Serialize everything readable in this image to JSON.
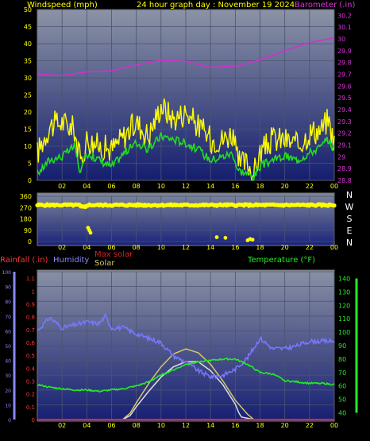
{
  "chart_data": [
    {
      "type": "line",
      "title": "24 hour graph day : November 19 2024",
      "ylabel": "Windspeed (mph)",
      "y2label": "Barometer (.in)",
      "x_ticks": [
        "02",
        "04",
        "06",
        "08",
        "10",
        "12",
        "14",
        "16",
        "18",
        "20",
        "22",
        "00"
      ],
      "ylim": [
        0,
        50
      ],
      "y_ticks": [
        0,
        5,
        10,
        15,
        20,
        25,
        30,
        35,
        40,
        45,
        50
      ],
      "y2lim": [
        28.8,
        30.25
      ],
      "y2_ticks": [
        "28.8",
        "28.9",
        "29",
        "29.1",
        "29.2",
        "29.3",
        "29.4",
        "29.5",
        "29.6",
        "29.7",
        "29.8",
        "29.9",
        "30",
        "30.1",
        "30.2"
      ],
      "colors": {
        "gust": "#ffff00",
        "average": "#22dd22",
        "barometer": "#cc33cc"
      },
      "series": [
        {
          "key": "gust",
          "x": [
            0,
            1,
            2,
            3,
            3.5,
            4,
            5,
            6,
            7,
            8,
            9,
            10,
            11,
            12,
            13,
            14,
            15,
            15.8,
            16.2,
            17,
            17.5,
            18,
            19,
            20,
            21,
            22,
            23,
            23.5,
            24
          ],
          "values": [
            8,
            16,
            17,
            15,
            5,
            12,
            10,
            9,
            13,
            17,
            13,
            22,
            18,
            20,
            16,
            12,
            12,
            14,
            5,
            5,
            2,
            8,
            12,
            12,
            10,
            14,
            15,
            18,
            11
          ]
        },
        {
          "key": "average",
          "x": [
            0,
            1,
            2,
            3,
            3.5,
            4,
            5,
            6,
            7,
            8,
            9,
            10,
            11,
            12,
            13,
            14,
            15,
            15.8,
            16.2,
            17,
            17.5,
            18,
            19,
            20,
            21,
            22,
            23,
            23.5,
            24
          ],
          "values": [
            2,
            6,
            7,
            10,
            2,
            8,
            6,
            4,
            8,
            11,
            9,
            13,
            12,
            11,
            9,
            6,
            7,
            8,
            3,
            2,
            1,
            4,
            6,
            7,
            6,
            8,
            10,
            12,
            9
          ]
        },
        {
          "key": "barometer",
          "x": [
            0,
            2,
            4,
            6,
            8,
            10,
            12,
            14,
            16,
            18,
            20,
            22,
            24
          ],
          "values": [
            29.7,
            29.69,
            29.72,
            29.73,
            29.78,
            29.82,
            29.81,
            29.76,
            29.77,
            29.82,
            29.9,
            29.97,
            30.01
          ]
        }
      ]
    },
    {
      "type": "scatter",
      "ylim": [
        0,
        360
      ],
      "y_ticks": [
        0,
        90,
        180,
        270,
        360
      ],
      "compass": [
        "N",
        "W",
        "S",
        "E",
        "N"
      ],
      "x_ticks": [
        "02",
        "04",
        "06",
        "08",
        "10",
        "12",
        "14",
        "16",
        "18",
        "20",
        "22",
        "00"
      ],
      "colors": {
        "points": "#ffff00"
      },
      "series": [
        {
          "key": "direction",
          "x": [
            0,
            1,
            2,
            3,
            3.5,
            3.8,
            4,
            5,
            6,
            8,
            10,
            12,
            14,
            15.5,
            16,
            17,
            18,
            20,
            22,
            24,
            4.1,
            4.2,
            4.3,
            14.5,
            15.2,
            17,
            17.2,
            17.4
          ],
          "values": [
            290,
            285,
            290,
            280,
            278,
            276,
            290,
            288,
            290,
            292,
            292,
            294,
            292,
            295,
            290,
            285,
            292,
            292,
            290,
            292,
            110,
            90,
            70,
            35,
            30,
            10,
            20,
            15
          ]
        }
      ]
    },
    {
      "type": "line",
      "legend": {
        "rain": "Rainfall (.in)",
        "humidity": "Humidity",
        "max_solar": "Max solar",
        "solar": "Solar",
        "temperature": "Temperature (°F)"
      },
      "humidity_ticks": [
        0,
        10,
        20,
        30,
        40,
        50,
        60,
        70,
        80,
        90,
        100
      ],
      "rain_ticks": [
        "0",
        "0.1",
        "0.2",
        "0.3",
        "0.4",
        "0.5",
        "0.6",
        "0.7",
        "0.8",
        "0.9",
        "1",
        "1.1"
      ],
      "temp_ticks": [
        40,
        50,
        60,
        70,
        80,
        90,
        100,
        110,
        120,
        130,
        140
      ],
      "x_ticks": [
        "02",
        "04",
        "06",
        "08",
        "10",
        "12",
        "14",
        "16",
        "18",
        "20",
        "22",
        "00"
      ],
      "colors": {
        "rain": "#ff2222",
        "humidity": "#7777ff",
        "max_solar": "#d4c86a",
        "solar": "#dddddd",
        "temperature": "#22ee22"
      },
      "series": [
        {
          "key": "humidity",
          "x": [
            0,
            1,
            2,
            3,
            4,
            5,
            5.5,
            6,
            7,
            8,
            9,
            10,
            11,
            12,
            13,
            14,
            15,
            16,
            17,
            18,
            19,
            20,
            21,
            22,
            23,
            24
          ],
          "values": [
            60,
            69,
            62,
            64,
            66,
            65,
            70,
            62,
            62,
            58,
            55,
            52,
            43,
            39,
            33,
            29,
            30,
            34,
            42,
            55,
            48,
            48,
            50,
            53,
            53,
            53
          ]
        },
        {
          "key": "temperature",
          "x": [
            0,
            1,
            2,
            3,
            4,
            5,
            6,
            7,
            8,
            9,
            10,
            11,
            12,
            13,
            14,
            15,
            16,
            17,
            18,
            19,
            20,
            21,
            22,
            23,
            24
          ],
          "values": [
            61,
            59,
            58,
            57,
            57,
            56,
            57,
            58,
            60,
            63,
            68,
            72,
            76,
            78,
            79,
            80,
            80,
            76,
            70,
            69,
            64,
            63,
            62,
            62,
            61
          ]
        },
        {
          "key": "max_solar",
          "x": [
            6.9,
            7.5,
            8,
            9,
            10,
            11,
            12,
            13,
            14,
            15,
            16,
            17,
            17.5,
            17.6
          ],
          "values": [
            0,
            0.05,
            0.13,
            0.28,
            0.41,
            0.51,
            0.55,
            0.52,
            0.43,
            0.3,
            0.15,
            0.04,
            0,
            0
          ]
        },
        {
          "key": "solar",
          "x": [
            6.9,
            7.5,
            8,
            9,
            10,
            11,
            12,
            13,
            14,
            15,
            16,
            16.3,
            16.5,
            17,
            17.5
          ],
          "values": [
            0,
            0.03,
            0.1,
            0.22,
            0.33,
            0.41,
            0.45,
            0.45,
            0.38,
            0.27,
            0.12,
            0.05,
            0.02,
            0.01,
            0
          ]
        },
        {
          "key": "rain",
          "x": [
            0,
            24
          ],
          "values": [
            0,
            0
          ]
        }
      ]
    }
  ]
}
